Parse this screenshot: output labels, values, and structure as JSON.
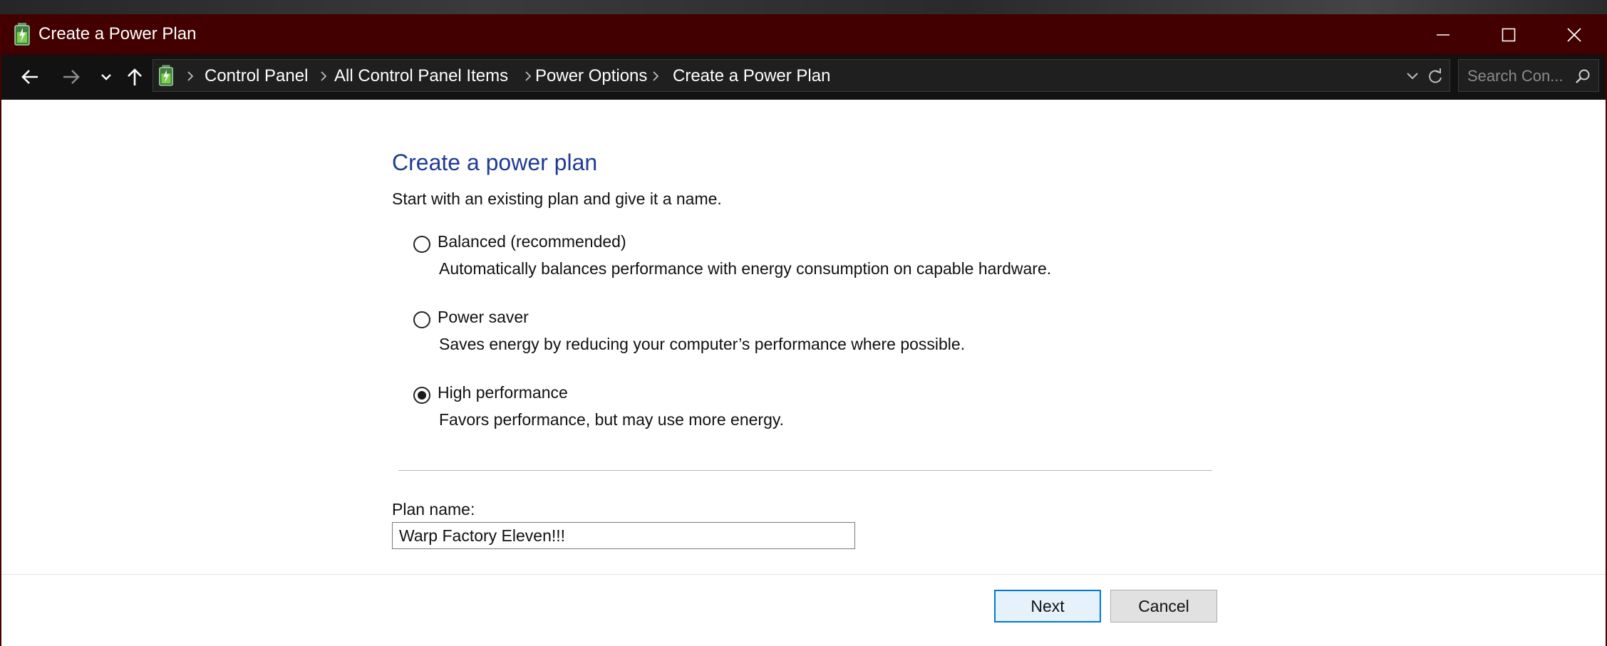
{
  "window": {
    "title": "Create a Power Plan",
    "controls": {
      "minimize_icon": "minimize-icon",
      "maximize_icon": "maximize-icon",
      "close_icon": "close-icon"
    }
  },
  "address_bar": {
    "breadcrumbs": [
      "Control Panel",
      "All Control Panel Items",
      "Power Options",
      "Create a Power Plan"
    ],
    "search_placeholder": "Search Con..."
  },
  "content": {
    "heading": "Create a power plan",
    "intro": "Start with an existing plan and give it a name.",
    "options": [
      {
        "label": "Balanced (recommended)",
        "description": "Automatically balances performance with energy consumption on capable hardware.",
        "selected": false
      },
      {
        "label": "Power saver",
        "description": "Saves energy by reducing your computer’s performance where possible.",
        "selected": false
      },
      {
        "label": "High performance",
        "description": "Favors performance, but may use more energy.",
        "selected": true
      }
    ],
    "plan_name_label": "Plan name:",
    "plan_name_value": "Warp Factory Eleven!!!"
  },
  "buttons": {
    "next": "Next",
    "cancel": "Cancel"
  },
  "colors": {
    "titlebar": "#420000",
    "heading": "#1e3c96",
    "default_button_border": "#0078d7"
  }
}
